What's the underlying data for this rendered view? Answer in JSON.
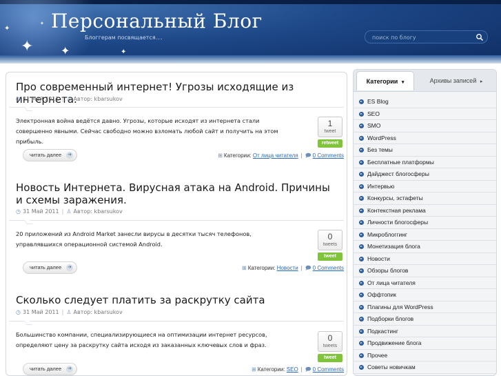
{
  "header": {
    "title": "Персональный Блог",
    "tagline": "Блоггерам посвящается....",
    "search_placeholder": "поиск по блогу",
    "search_icon": "search-icon"
  },
  "posts": [
    {
      "title": "Про современный интернет! Угрозы исходящие из интернета.",
      "date": "31 Май 2011",
      "author": "Автор: kbarsukov",
      "excerpt": "Электронная война ведётся давно. Угрозы, которые исходят из интернета стали совершенно явными. Сейчас свободно можно взломать любой сайт и получить на этом прибыль.",
      "tweet_count": "1",
      "tweet_label": "tweet",
      "tweet_button": "retweet",
      "read_more": "читать далее",
      "categories_label": "Категории:",
      "category": "От лица читателя",
      "comments": "0 Comments"
    },
    {
      "title": "Новость Интернета. Вирусная атака на Android. Причины и схемы заражения.",
      "date": "31 Май 2011",
      "author": "Автор: kbarsukov",
      "excerpt": "20 приложений из Android Market занесли вирусы в десятки тысяч телефонов, управлявшихся операционной системой Android.",
      "tweet_count": "0",
      "tweet_label": "tweets",
      "tweet_button": "tweet",
      "read_more": "читать далее",
      "categories_label": "Категории:",
      "category": "Новости",
      "comments": "0 Comments"
    },
    {
      "title": "Сколько следует платить за раскрутку сайта",
      "date": "31 Май 2011",
      "author": "Автор: kbarsukov",
      "excerpt": "Большинство компании, специализирующиеся на оптимизации интернет ресурсов, определяют цену за раскрутку сайта исходя из заказанных ключевых слов и фраз.",
      "tweet_count": "0",
      "tweet_label": "tweets",
      "tweet_button": "tweet",
      "read_more": "читать далее",
      "categories_label": "Категории:",
      "category": "SEO",
      "comments": "0 Comments"
    }
  ],
  "sidebar": {
    "tab_active": "Категории",
    "tab_inactive": "Архивы записей",
    "categories": [
      "ES Blog",
      "SEO",
      "SMO",
      "WordPress",
      "Без темы",
      "Бесплатные платформы",
      "Дайджест блогосферы",
      "Интервью",
      "Конкурсы, эстафеты",
      "Контекстная реклама",
      "Личности блогосферы",
      "Микроблоггинг",
      "Монетизация блога",
      "Новости",
      "Обзоры блогов",
      "От лица читателя",
      "Оффтопик",
      "Плагины для WordPress",
      "Подборки блогов",
      "Подкастинг",
      "Продвижение блога",
      "Прочее",
      "Советы новичкам"
    ]
  }
}
